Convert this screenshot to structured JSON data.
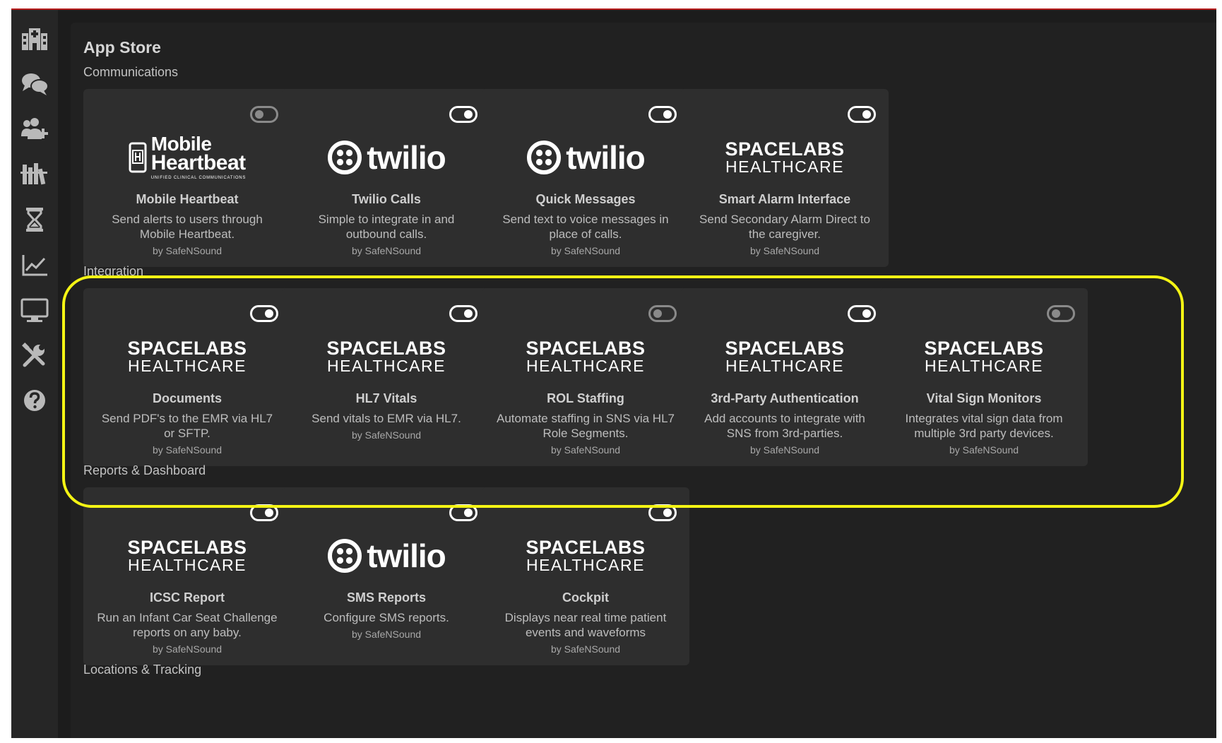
{
  "page": {
    "title": "App Store"
  },
  "colors": {
    "accent_highlight": "#f4f414",
    "top_bar": "#b71c1c",
    "card_bg": "#2e2e2e"
  },
  "sidebar": {
    "items": [
      {
        "icon": "hospital-icon"
      },
      {
        "icon": "chat-icon"
      },
      {
        "icon": "users-icon"
      },
      {
        "icon": "library-icon"
      },
      {
        "icon": "hourglass-icon"
      },
      {
        "icon": "chart-icon"
      },
      {
        "icon": "monitor-icon"
      },
      {
        "icon": "tools-icon"
      },
      {
        "icon": "help-icon"
      }
    ]
  },
  "logos": {
    "spacelabs_line1": "SPACELABS",
    "spacelabs_line2": "HEALTHCARE",
    "twilio": "twilio",
    "mobile_heartbeat_line1": "Mobile",
    "mobile_heartbeat_line2": "Heartbeat",
    "mobile_heartbeat_sub": "UNIFIED CLINICAL COMMUNICATIONS"
  },
  "sections": [
    {
      "label": "Communications",
      "cards": [
        {
          "title": "Mobile Heartbeat",
          "desc": "Send alerts to users through Mobile Heartbeat.",
          "by": "by SafeNSound",
          "enabled": false,
          "logo": "mobile-heartbeat"
        },
        {
          "title": "Twilio Calls",
          "desc": "Simple to integrate in and outbound calls.",
          "by": "by SafeNSound",
          "enabled": true,
          "logo": "twilio"
        },
        {
          "title": "Quick Messages",
          "desc": "Send text to voice messages in place of calls.",
          "by": "by SafeNSound",
          "enabled": true,
          "logo": "twilio"
        },
        {
          "title": "Smart Alarm Interface",
          "desc": "Send Secondary Alarm Direct to the caregiver.",
          "by": "by SafeNSound",
          "enabled": true,
          "logo": "spacelabs"
        }
      ]
    },
    {
      "label": "Integration",
      "cards": [
        {
          "title": "Documents",
          "desc": "Send PDF's to the EMR via HL7 or SFTP.",
          "by": "by SafeNSound",
          "enabled": true,
          "logo": "spacelabs"
        },
        {
          "title": "HL7 Vitals",
          "desc": "Send vitals to EMR via HL7.",
          "by": "by SafeNSound",
          "enabled": true,
          "logo": "spacelabs"
        },
        {
          "title": "ROL Staffing",
          "desc": "Automate staffing in SNS via HL7 Role Segments.",
          "by": "by SafeNSound",
          "enabled": false,
          "logo": "spacelabs"
        },
        {
          "title": "3rd-Party Authentication",
          "desc": "Add accounts to integrate with SNS from 3rd-parties.",
          "by": "by SafeNSound",
          "enabled": true,
          "logo": "spacelabs"
        },
        {
          "title": "Vital Sign Monitors",
          "desc": "Integrates vital sign data from multiple 3rd party devices.",
          "by": "by SafeNSound",
          "enabled": false,
          "logo": "spacelabs"
        }
      ]
    },
    {
      "label": "Reports & Dashboard",
      "cards": [
        {
          "title": "ICSC Report",
          "desc": "Run an Infant Car Seat Challenge reports on any baby.",
          "by": "by SafeNSound",
          "enabled": true,
          "logo": "spacelabs"
        },
        {
          "title": "SMS Reports",
          "desc": "Configure SMS reports.",
          "by": "by SafeNSound",
          "enabled": true,
          "logo": "twilio"
        },
        {
          "title": "Cockpit",
          "desc": "Displays near real time patient events and waveforms",
          "by": "by SafeNSound",
          "enabled": true,
          "logo": "spacelabs"
        }
      ]
    },
    {
      "label": "Locations & Tracking",
      "cards": []
    }
  ]
}
